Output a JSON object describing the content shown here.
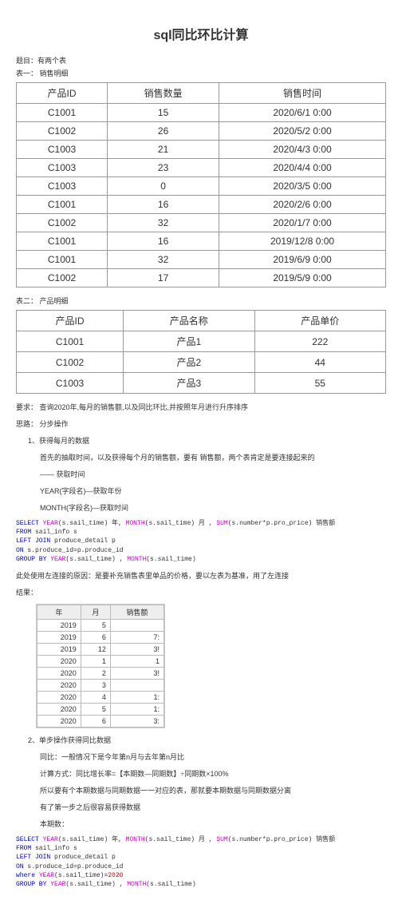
{
  "title": "sql同比环比计算",
  "subtitle_prefix": "题目：",
  "subtitle_text": "有两个表",
  "t1_label": "表一：  销售明细",
  "t1_headers": [
    "产品ID",
    "销售数量",
    "销售时间"
  ],
  "t1_rows": [
    [
      "C1001",
      "15",
      "2020/6/1 0:00"
    ],
    [
      "C1002",
      "26",
      "2020/5/2 0:00"
    ],
    [
      "C1003",
      "21",
      "2020/4/3 0:00"
    ],
    [
      "C1003",
      "23",
      "2020/4/4 0:00"
    ],
    [
      "C1003",
      "0",
      "2020/3/5 0:00"
    ],
    [
      "C1001",
      "16",
      "2020/2/6 0:00"
    ],
    [
      "C1002",
      "32",
      "2020/1/7 0:00"
    ],
    [
      "C1001",
      "16",
      "2019/12/8 0:00"
    ],
    [
      "C1001",
      "32",
      "2019/6/9 0:00"
    ],
    [
      "C1002",
      "17",
      "2019/5/9 0:00"
    ]
  ],
  "t2_label": "表二：  产品明细",
  "t2_headers": [
    "产品ID",
    "产品名称",
    "产品单价"
  ],
  "t2_rows": [
    [
      "C1001",
      "产品1",
      "222"
    ],
    [
      "C1002",
      "产品2",
      "44"
    ],
    [
      "C1003",
      "产品3",
      "55"
    ]
  ],
  "req": "要求：  查询2020年,每月的销售额,以及同比环比,并按照年月进行升序排序",
  "think_label": "思路：  分步操作",
  "step1_title": "1、获得每月的数据",
  "step1_line1": "首先的抽取时间，以及获得每个月的销售额，要有 销售额，两个表肯定是要连接起来的",
  "step1_line2": "—— 获取时间",
  "step1_line3": "YEAR(字段名)—获取年份",
  "step1_line4": "MONTH(字段名)—获取时间",
  "code1_a": {
    "kw1": "SELECT",
    "fn1": "YEAR",
    "t1": "(s.sail_time) 年, ",
    "fn2": "MONTH",
    "t2": "(s.sail_time) 月 , ",
    "fn3": "SUM",
    "t3": "(s.number*p.pro_price) 销售额"
  },
  "code1_b": {
    "kw": "FROM",
    "t": "  sail_info s"
  },
  "code1_c": {
    "kw": "LEFT JOIN",
    "t": " produce_detail p"
  },
  "code1_d": {
    "kw": "ON",
    "t": " s.produce_id=p.produce_id"
  },
  "code1_e": {
    "kw": "GROUP BY",
    "fn1": "YEAR",
    "t1": "(s.sail_time) , ",
    "fn2": "MONTH",
    "t2": "(s.sail_time)"
  },
  "note1": "此处使用左连接的原因：是要补充销售表里单品的价格，要以左表为基准，用了左连接",
  "result_label": "结果：",
  "pic_headers": [
    "年",
    "月",
    "销售额"
  ],
  "pic_rows": [
    [
      "2019",
      "5",
      ""
    ],
    [
      "2019",
      "6",
      "7:"
    ],
    [
      "2019",
      "12",
      "3!"
    ],
    [
      "2020",
      "1",
      "1"
    ],
    [
      "2020",
      "2",
      "3!"
    ],
    [
      "2020",
      "3",
      ""
    ],
    [
      "2020",
      "4",
      "1:"
    ],
    [
      "2020",
      "5",
      "1:"
    ],
    [
      "2020",
      "6",
      "3:"
    ]
  ],
  "step2_title": "2、单步操作获得同比数据",
  "step2_line1": "同比：一般情况下是今年第n月与去年第n月比",
  "step2_line2": "计算方式：同比增长率=【本期数—同期数】÷同期数×100%",
  "step2_line3": "所以要有个本期数据与同期数据一一对应的表，那就要本期数据与同期数据分离",
  "step2_line4": "有了第一步之后很容易获得数据",
  "step2_line5": "本期数：",
  "code2_a": {
    "kw1": "SELECT",
    "fn1": "YEAR",
    "t1": "(s.sail_time) 年, ",
    "fn2": "MONTH",
    "t2": "(s.sail_time) 月 , ",
    "fn3": "SUM",
    "t3": "(s.number*p.pro_price) 销售额"
  },
  "code2_b": {
    "kw": "FROM",
    "t": "  sail_info s"
  },
  "code2_c": {
    "kw": "LEFT JOIN",
    "t": " produce_detail p"
  },
  "code2_d": {
    "kw": "ON",
    "t": " s.produce_id=p.produce_id"
  },
  "code2_e": {
    "kw": "where",
    "fn": "YEAR",
    "t1": "(s.sail_time)=",
    "num": "2020"
  },
  "code2_f": {
    "kw": "GROUP BY",
    "fn1": "YEAR",
    "t1": "(s.sail_time) , ",
    "fn2": "MONTH",
    "t2": "(s.sail_time)"
  }
}
